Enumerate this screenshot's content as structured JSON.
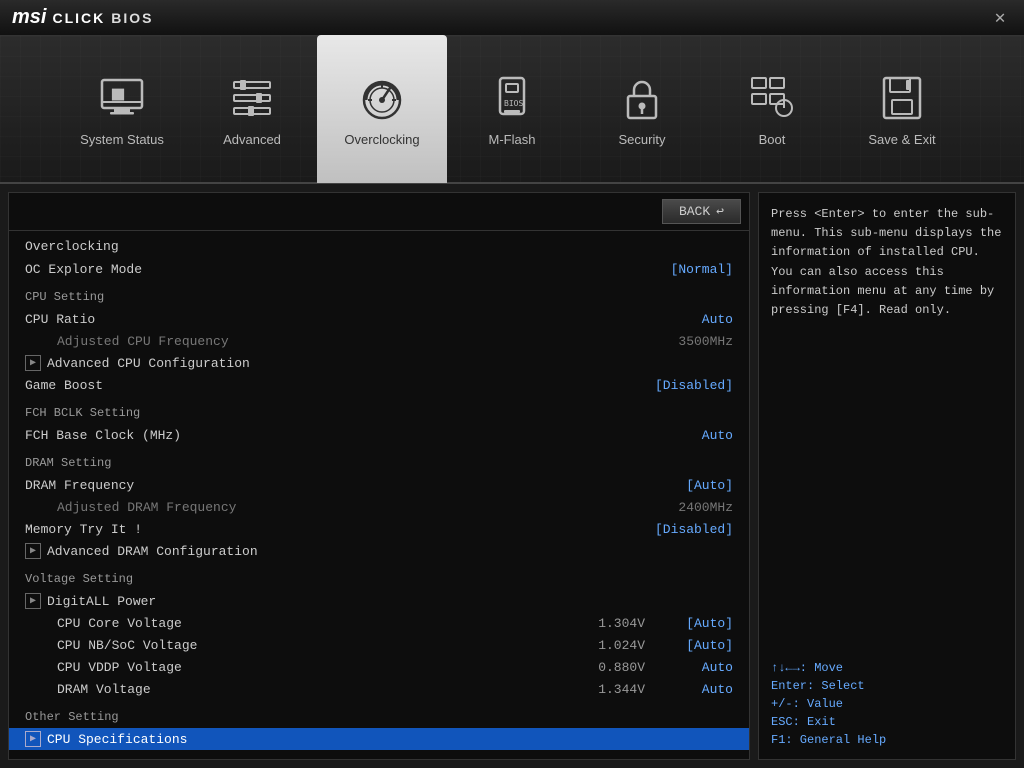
{
  "titlebar": {
    "logo_msi": "msi",
    "logo_click": "CLICK",
    "logo_bios": "BIOS",
    "close_label": "✕"
  },
  "navbar": {
    "items": [
      {
        "id": "system-status",
        "label": "System Status",
        "icon": "monitor"
      },
      {
        "id": "advanced",
        "label": "Advanced",
        "icon": "sliders"
      },
      {
        "id": "overclocking",
        "label": "Overclocking",
        "icon": "gauge",
        "active": true
      },
      {
        "id": "m-flash",
        "label": "M-Flash",
        "icon": "usb"
      },
      {
        "id": "security",
        "label": "Security",
        "icon": "lock"
      },
      {
        "id": "boot",
        "label": "Boot",
        "icon": "power"
      },
      {
        "id": "save-exit",
        "label": "Save & Exit",
        "icon": "save"
      }
    ]
  },
  "panel": {
    "section_title": "Overclocking",
    "back_label": "BACK",
    "settings": [
      {
        "type": "row",
        "name": "OC Explore Mode",
        "value": "[Normal]"
      },
      {
        "type": "group",
        "label": "CPU Setting"
      },
      {
        "type": "row",
        "name": "CPU Ratio",
        "value": "Auto"
      },
      {
        "type": "row",
        "name": "Adjusted CPU Frequency",
        "value": "3500MHz",
        "dimmed": true
      },
      {
        "type": "sub",
        "name": "Advanced CPU Configuration",
        "value": ""
      },
      {
        "type": "row",
        "name": "Game Boost",
        "value": "[Disabled]"
      },
      {
        "type": "group",
        "label": "FCH BCLK Setting"
      },
      {
        "type": "row",
        "name": "FCH Base Clock (MHz)",
        "value": "Auto"
      },
      {
        "type": "group",
        "label": "DRAM Setting"
      },
      {
        "type": "row",
        "name": "DRAM Frequency",
        "value": "[Auto]"
      },
      {
        "type": "row",
        "name": "Adjusted DRAM Frequency",
        "value": "2400MHz",
        "dimmed": true
      },
      {
        "type": "row",
        "name": "Memory Try It !",
        "value": "[Disabled]"
      },
      {
        "type": "sub",
        "name": "Advanced DRAM Configuration",
        "value": ""
      },
      {
        "type": "group",
        "label": "Voltage Setting"
      },
      {
        "type": "sub",
        "name": "DigitALL Power",
        "value": ""
      },
      {
        "type": "row2",
        "name": "CPU Core Voltage",
        "val1": "1.304V",
        "value": "[Auto]"
      },
      {
        "type": "row2",
        "name": "CPU NB/SoC Voltage",
        "val1": "1.024V",
        "value": "[Auto]"
      },
      {
        "type": "row2",
        "name": "CPU VDDP Voltage",
        "val1": "0.880V",
        "value": "Auto"
      },
      {
        "type": "row2",
        "name": "DRAM Voltage",
        "val1": "1.344V",
        "value": "Auto"
      },
      {
        "type": "group",
        "label": "Other Setting"
      },
      {
        "type": "sub-active",
        "name": "CPU Specifications",
        "value": ""
      }
    ]
  },
  "help": {
    "text": "Press <Enter> to enter the sub-menu. This sub-menu displays the information of installed CPU. You can also access this information menu at any time by pressing [F4]. Read only."
  },
  "keyguide": {
    "items": [
      {
        "key": "↑↓←→: Move"
      },
      {
        "key": "Enter: Select"
      },
      {
        "key": "+/-: Value"
      },
      {
        "key": "ESC: Exit"
      },
      {
        "key": "F1: General Help"
      }
    ]
  }
}
